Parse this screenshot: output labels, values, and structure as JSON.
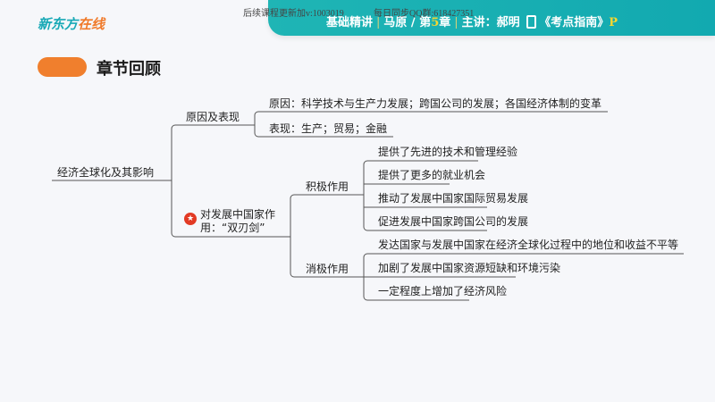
{
  "watermark": {
    "left": "后续课程更新加v:1003019",
    "right": "每日同步QQ群:618427351"
  },
  "logo": {
    "part1": "新东方",
    "part2": "在线"
  },
  "header": {
    "course": "基础精讲",
    "subject": "马原 / 第",
    "chapter_num": "5",
    "chapter_suffix": "章",
    "lecturer": "主讲：郝明",
    "book": "《考点指南》",
    "book_suffix": "P"
  },
  "section_title": "章节回顾",
  "mindmap": {
    "root": "经济全球化及其影响",
    "branch1": {
      "label": "原因及表现",
      "children": [
        "原因：科学技术与生产力发展；跨国公司的发展；各国经济体制的变革",
        "表现：生产；贸易；金融"
      ]
    },
    "branch2": {
      "label_line1": "对发展中国家作",
      "label_line2": "用：“双刃剑”",
      "positive": {
        "label": "积极作用",
        "children": [
          "提供了先进的技术和管理经验",
          "提供了更多的就业机会",
          "推动了发展中国家国际贸易发展",
          "促进发展中国家跨国公司的发展"
        ]
      },
      "negative": {
        "label": "消极作用",
        "children": [
          "发达国家与发展中国家在经济全球化过程中的地位和收益不平等",
          "加剧了发展中国家资源短缺和环境污染",
          "一定程度上增加了经济风险"
        ]
      }
    }
  }
}
